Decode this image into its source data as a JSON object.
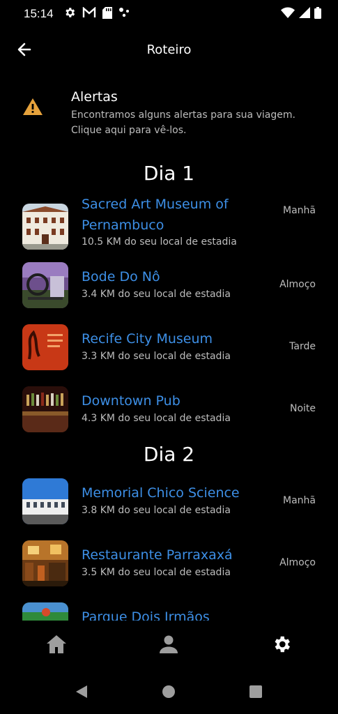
{
  "status_bar": {
    "time": "15:14",
    "left_icons": [
      "gear-icon",
      "gmail-icon",
      "sd-card-icon",
      "dots-icon"
    ],
    "right_icons": [
      "wifi-icon",
      "signal-icon",
      "battery-icon"
    ]
  },
  "app_bar": {
    "title": "Roteiro",
    "back_icon": "arrow-left-icon"
  },
  "alert": {
    "title": "Alertas",
    "text_line1": "Encontramos alguns alertas para sua viagem.",
    "text_line2": "Clique aqui para vê-los.",
    "icon": "warning-icon",
    "color": "#e6a23c"
  },
  "days": [
    {
      "title": "Dia 1",
      "places": [
        {
          "name_line1": "Sacred Art Museum of",
          "name_line2": "Pernambuco",
          "distance": "10.5 KM do seu local de estadia",
          "period": "Manhã"
        },
        {
          "name_line1": "Bode Do Nô",
          "distance": "3.4 KM do seu local de estadia",
          "period": "Almoço"
        },
        {
          "name_line1": "Recife City Museum",
          "distance": "3.3 KM do seu local de estadia",
          "period": "Tarde"
        },
        {
          "name_line1": "Downtown Pub",
          "distance": "4.3 KM do seu local de estadia",
          "period": "Noite"
        }
      ]
    },
    {
      "title": "Dia 2",
      "places": [
        {
          "name_line1": "Memorial Chico Science",
          "distance": "3.8 KM do seu local de estadia",
          "period": "Manhã"
        },
        {
          "name_line1": "Restaurante Parraxaxá",
          "distance": "3.5 KM do seu local de estadia",
          "period": "Almoço"
        },
        {
          "name_line1": "Parque Dois Irmãos"
        }
      ]
    }
  ],
  "bottom_nav": {
    "items": [
      "home-icon",
      "person-icon",
      "settings-icon"
    ],
    "active": "settings-icon"
  },
  "colors": {
    "accent": "#3d8fe6",
    "background": "#000000",
    "secondary_text": "#bdbdbd"
  }
}
